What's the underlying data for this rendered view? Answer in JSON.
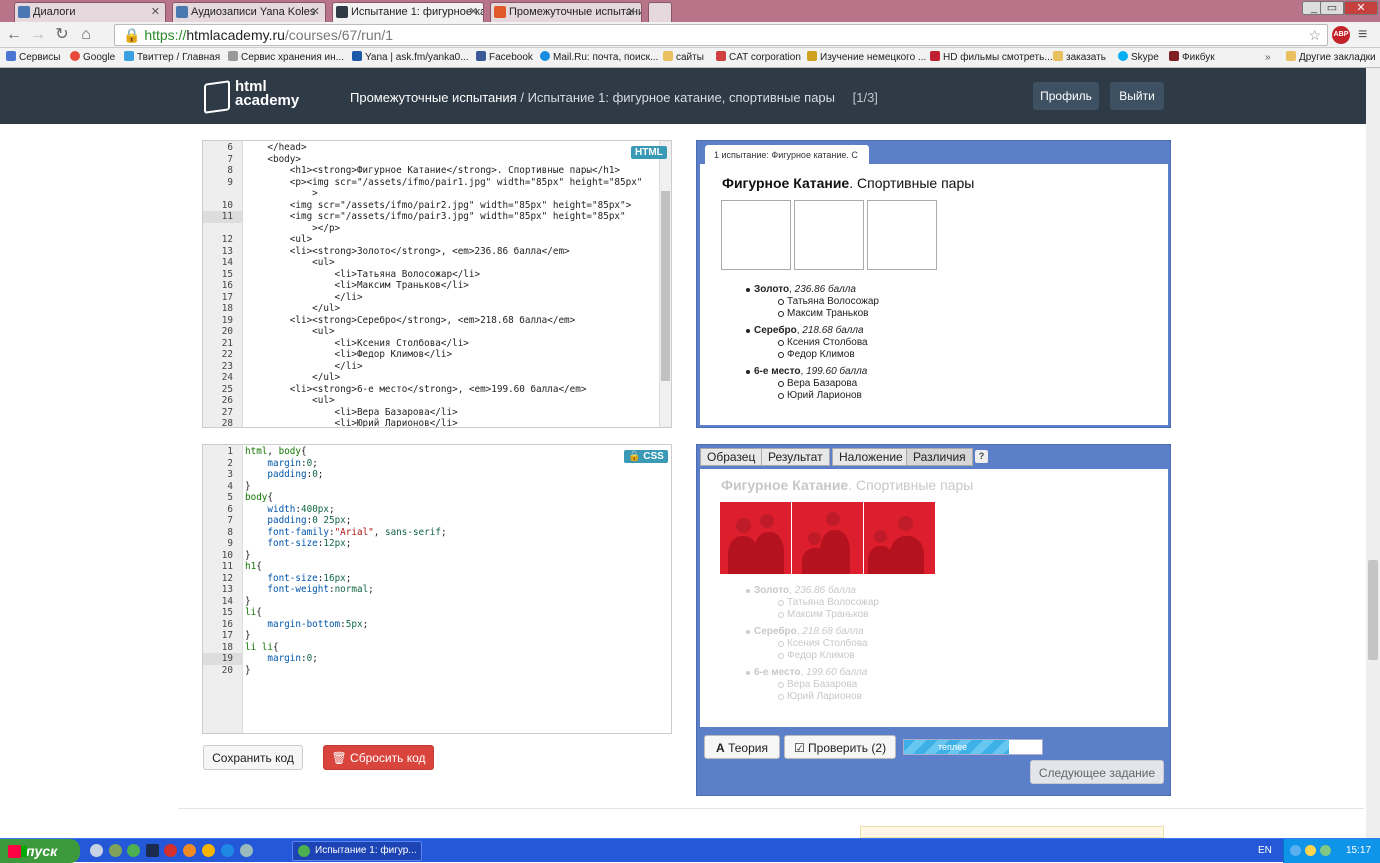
{
  "browser": {
    "tabs": [
      {
        "label": "Диалоги",
        "active": false
      },
      {
        "label": "Аудиозаписи Yana Koles",
        "active": false
      },
      {
        "label": "Испытание 1: фигурное ка",
        "active": true
      },
      {
        "label": "Промежуточные испытани",
        "active": false
      }
    ],
    "url_scheme": "https://",
    "url_host": "htmlacademy.ru",
    "url_path": "/courses/67/run/1",
    "abp_label": "ABP",
    "bookmarks": [
      {
        "label": "Сервисы",
        "color": "#4a78d0"
      },
      {
        "label": "Google",
        "color": "#e84a3a"
      },
      {
        "label": "Твиттер / Главная",
        "color": "#3aa0e0"
      },
      {
        "label": "Сервис хранения ин...",
        "color": "#999999"
      },
      {
        "label": "Yana | ask.fm/yanka0...",
        "color": "#1a5aa8"
      },
      {
        "label": "Facebook",
        "color": "#3b5998"
      },
      {
        "label": "Mail.Ru: почта, поиск...",
        "color": "#168de2"
      },
      {
        "label": "сайты",
        "color": "#e8c060"
      },
      {
        "label": "CAT corporation",
        "color": "#d04040"
      },
      {
        "label": "Изучение немецкого ...",
        "color": "#d0a020"
      },
      {
        "label": "HD фильмы смотреть...",
        "color": "#c02030"
      },
      {
        "label": "заказать",
        "color": "#e8c060"
      },
      {
        "label": "Skype",
        "color": "#00aff0"
      },
      {
        "label": "Фикбук",
        "color": "#802020"
      },
      {
        "label": "Другие закладки",
        "color": "#e8c060"
      }
    ]
  },
  "site": {
    "logo_line1": "html",
    "logo_line2": "academy",
    "breadcrumb_bold": "Промежуточные испытания",
    "breadcrumb_rest": " / Испытание 1: фигурное катание, спортивные пары",
    "progress": "[1/3]",
    "profile_button": "Профиль",
    "logout_button": "Выйти"
  },
  "html_editor": {
    "badge": "HTML",
    "lines": [
      {
        "n": "6",
        "html": "    &lt;/head&gt;"
      },
      {
        "n": "7",
        "html": "    &lt;body&gt;"
      },
      {
        "n": "8",
        "html": "        &lt;h1&gt;&lt;strong&gt;Фигурное Катание&lt;/strong&gt;. Спортивные пары&lt;/h1&gt;"
      },
      {
        "n": "9",
        "html": "        &lt;p&gt;&lt;img scr=\"/assets/ifmo/pair1.jpg\" width=\"85px\" height=\"85px\""
      },
      {
        "n": "",
        "html": "            &gt;"
      },
      {
        "n": "10",
        "html": "        &lt;img scr=\"/assets/ifmo/pair2.jpg\" width=\"85px\" height=\"85px\"&gt;"
      },
      {
        "n": "11",
        "html": "        &lt;img scr=\"/assets/ifmo/pair3.jpg\" width=\"85px\" height=\"85px\"",
        "hl": true
      },
      {
        "n": "",
        "html": "            &gt;&lt;/p&gt;",
        "hl": true
      },
      {
        "n": "12",
        "html": "        &lt;ul&gt;"
      },
      {
        "n": "13",
        "html": "        &lt;li&gt;&lt;strong&gt;Золото&lt;/strong&gt;, &lt;em&gt;236.86 балла&lt;/em&gt;"
      },
      {
        "n": "14",
        "html": "            &lt;ul&gt;"
      },
      {
        "n": "15",
        "html": "                &lt;li&gt;Татьяна Волосожар&lt;/li&gt;"
      },
      {
        "n": "16",
        "html": "                &lt;li&gt;Максим Траньков&lt;/li&gt;"
      },
      {
        "n": "17",
        "html": "                &lt;/li&gt;"
      },
      {
        "n": "18",
        "html": "            &lt;/ul&gt;"
      },
      {
        "n": "19",
        "html": "        &lt;li&gt;&lt;strong&gt;Серебро&lt;/strong&gt;, &lt;em&gt;218.68 балла&lt;/em&gt;"
      },
      {
        "n": "20",
        "html": "            &lt;ul&gt;"
      },
      {
        "n": "21",
        "html": "                &lt;li&gt;Ксения Столбова&lt;/li&gt;"
      },
      {
        "n": "22",
        "html": "                &lt;li&gt;Федор Климов&lt;/li&gt;"
      },
      {
        "n": "23",
        "html": "                &lt;/li&gt;"
      },
      {
        "n": "24",
        "html": "            &lt;/ul&gt;"
      },
      {
        "n": "25",
        "html": "        &lt;li&gt;&lt;strong&gt;6-е место&lt;/strong&gt;, &lt;em&gt;199.60 балла&lt;/em&gt;"
      },
      {
        "n": "26",
        "html": "            &lt;ul&gt;"
      },
      {
        "n": "27",
        "html": "                &lt;li&gt;Вера Базарова&lt;/li&gt;"
      },
      {
        "n": "28",
        "html": "                &lt;li&gt;Юрий Ларионов&lt;/li&gt;"
      }
    ]
  },
  "css_editor": {
    "badge": "CSS",
    "lines": [
      {
        "n": "1",
        "html": "<span class=\"tg\">html</span>, <span class=\"tg\">body</span>{"
      },
      {
        "n": "2",
        "html": "    <span class=\"pr\">margin</span>:<span class=\"vl\">0</span>;"
      },
      {
        "n": "3",
        "html": "    <span class=\"pr\">padding</span>:<span class=\"vl\">0</span>;"
      },
      {
        "n": "4",
        "html": "}"
      },
      {
        "n": "5",
        "html": "<span class=\"tg\">body</span>{"
      },
      {
        "n": "6",
        "html": "    <span class=\"pr\">width</span>:<span class=\"vl\">400px</span>;"
      },
      {
        "n": "7",
        "html": "    <span class=\"pr\">padding</span>:<span class=\"vl\">0 25px</span>;"
      },
      {
        "n": "8",
        "html": "    <span class=\"pr\">font-family</span>:<span class=\"st\">\"Arial\"</span>, <span class=\"vl\">sans-serif</span>;"
      },
      {
        "n": "9",
        "html": "    <span class=\"pr\">font-size</span>:<span class=\"vl\">12px</span>;"
      },
      {
        "n": "10",
        "html": "}"
      },
      {
        "n": "11",
        "html": "<span class=\"tg\">h1</span>{"
      },
      {
        "n": "12",
        "html": "    <span class=\"pr\">font-size</span>:<span class=\"vl\">16px</span>;"
      },
      {
        "n": "13",
        "html": "    <span class=\"pr\">font-weight</span>:<span class=\"vl\">normal</span>;"
      },
      {
        "n": "14",
        "html": "}"
      },
      {
        "n": "15",
        "html": "<span class=\"tg\">li</span>{"
      },
      {
        "n": "16",
        "html": "    <span class=\"pr\">margin-bottom</span>:<span class=\"vl\">5px</span>;"
      },
      {
        "n": "17",
        "html": "}"
      },
      {
        "n": "18",
        "html": "<span class=\"tg\">li li</span>{"
      },
      {
        "n": "19",
        "html": "    <span class=\"pr\">margin</span>:<span class=\"vl\">0</span>;",
        "hl": true
      },
      {
        "n": "20",
        "html": "}"
      }
    ]
  },
  "actions": {
    "save": "Сохранить код",
    "reset": "Сбросить код"
  },
  "preview": {
    "tab_label": "1 испытание: Фигурное катание. С",
    "title_bold": "Фигурное Катание",
    "title_rest": ". Спортивные пары",
    "medals": [
      {
        "place": "Золото",
        "score": "236.86 балла",
        "names": [
          "Татьяна Волосожар",
          "Максим Траньков"
        ]
      },
      {
        "place": "Серебро",
        "score": "218.68 балла",
        "names": [
          "Ксения Столбова",
          "Федор Климов"
        ]
      },
      {
        "place": "6-е место",
        "score": "199.60 балла",
        "names": [
          "Вера Базарова",
          "Юрий Ларионов"
        ]
      }
    ]
  },
  "compare": {
    "tabs": [
      "Образец",
      "Результат",
      "Наложение",
      "Различия"
    ],
    "help": "?",
    "theory_button": "Теория",
    "check_button": "Проверить (2)",
    "progress_label": "теплее",
    "progress_fraction": 0.76,
    "next_button": "Следующее задание"
  },
  "taskbar": {
    "start": "пуск",
    "task": "Испытание 1: фигур...",
    "lang": "EN",
    "clock": "15:17"
  }
}
